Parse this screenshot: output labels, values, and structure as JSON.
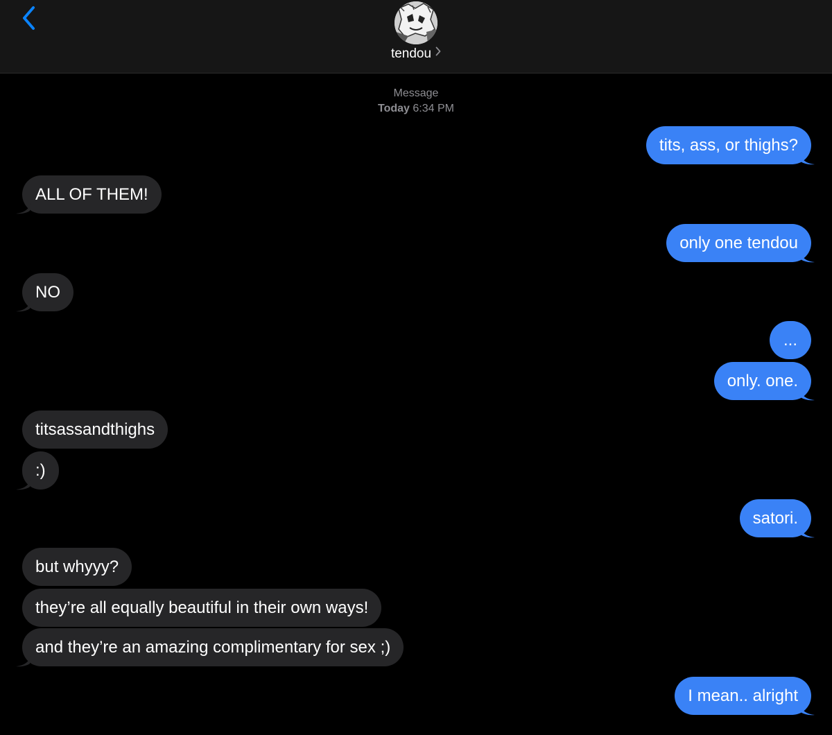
{
  "header": {
    "contact_name": "tendou"
  },
  "timestamp": {
    "label": "Message",
    "day": "Today",
    "time": "6:34 PM"
  },
  "colors": {
    "sent_bubble": "#3a82f6",
    "received_bubble": "#262628",
    "accent": "#0a84ff",
    "background": "#000000"
  },
  "messages": [
    {
      "from": "me",
      "text": "tits, ass, or thighs?"
    },
    {
      "from": "them",
      "text": "ALL OF THEM!"
    },
    {
      "from": "me",
      "text": "only one tendou"
    },
    {
      "from": "them",
      "text": "NO"
    },
    {
      "from": "me",
      "text": "..."
    },
    {
      "from": "me",
      "text": "only. one."
    },
    {
      "from": "them",
      "text": "titsassandthighs"
    },
    {
      "from": "them",
      "text": ":)"
    },
    {
      "from": "me",
      "text": "satori."
    },
    {
      "from": "them",
      "text": "but whyyy?"
    },
    {
      "from": "them",
      "text": "they’re all equally beautiful in their own ways!"
    },
    {
      "from": "them",
      "text": "and they’re an amazing complimentary for sex ;)"
    },
    {
      "from": "me",
      "text": "I mean.. alright"
    }
  ]
}
